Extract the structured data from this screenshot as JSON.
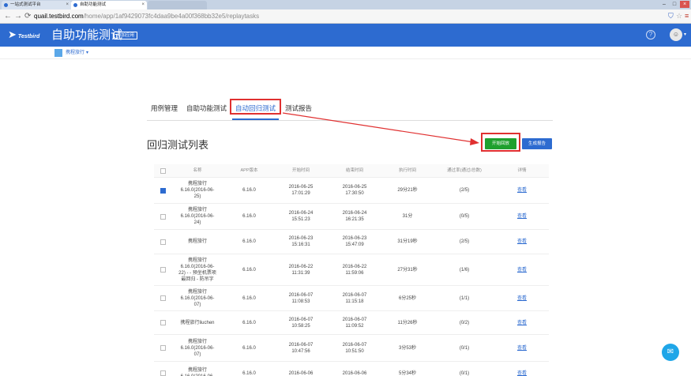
{
  "browser": {
    "tabs": [
      {
        "label": "一站式测试平台",
        "state": "inactive"
      },
      {
        "label": "自助功能测试",
        "state": "active"
      },
      {
        "label": "",
        "state": "faded"
      }
    ],
    "url_host": "quail.testbird.com",
    "url_path": "/home/app/1af9429073fc4daa9be4a00f368bb32e5/replaytasks",
    "back_icon": "arrow-left-icon",
    "forward_icon": "arrow-right-icon",
    "reload_icon": "reload-icon"
  },
  "header": {
    "logo_text": "Testbird",
    "title": "自助功能测试",
    "badge": "添加应用",
    "help_icon": "help-circle-icon",
    "avatar_icon": "user-avatar-icon"
  },
  "app_selector": {
    "name": "携程旅行",
    "caret": "▾"
  },
  "tabs": [
    {
      "label": "用例管理",
      "active": false
    },
    {
      "label": "自助功能测试",
      "active": false
    },
    {
      "label": "自动回归测试",
      "active": true
    },
    {
      "label": "测试报告",
      "active": false
    }
  ],
  "section": {
    "title": "回归测试列表",
    "start_button": "开始回放",
    "report_button": "生成报告"
  },
  "table": {
    "headers": [
      "",
      "名称",
      "APP版本",
      "开始时间",
      "结束时间",
      "执行时间",
      "通过率(通过/总数)",
      "详情"
    ],
    "rows": [
      {
        "name": [
          "携程旅行",
          "6.16.0(2016-06-",
          "25)"
        ],
        "version": "6.16.0",
        "start": [
          "2016-06-25",
          "17:01:29"
        ],
        "end": [
          "2016-06-25",
          "17:30:50"
        ],
        "duration": "29分21秒",
        "pass": "(2/5)",
        "detail": "查看",
        "checked": true
      },
      {
        "name": [
          "携程旅行",
          "6.16.0(2016-06-",
          "24)"
        ],
        "version": "6.16.0",
        "start": [
          "2016-06-24",
          "15:51:23"
        ],
        "end": [
          "2016-06-24",
          "16:21:35"
        ],
        "duration": "31分",
        "pass": "(0/5)",
        "detail": "查看",
        "checked": false
      },
      {
        "name": [
          "携程旅行"
        ],
        "version": "6.16.0",
        "start": [
          "2016-06-23",
          "15:16:31"
        ],
        "end": [
          "2016-06-23",
          "15:47:09"
        ],
        "duration": "31分19秒",
        "pass": "(2/5)",
        "detail": "查看",
        "checked": false
      },
      {
        "name": [
          "携程旅行",
          "6.16.0(2016-06-",
          "22) - - 预坐机票项",
          "最回归 - 防吊字"
        ],
        "version": "6.16.0",
        "start": [
          "2016-06-22",
          "11:31:39"
        ],
        "end": [
          "2016-06-22",
          "11:59:06"
        ],
        "duration": "27分31秒",
        "pass": "(1/6)",
        "detail": "查看",
        "checked": false
      },
      {
        "name": [
          "携程旅行",
          "6.16.0(2016-06-",
          "07)"
        ],
        "version": "6.16.0",
        "start": [
          "2016-06-07",
          "11:08:53"
        ],
        "end": [
          "2016-06-07",
          "11:15:18"
        ],
        "duration": "6分25秒",
        "pass": "(1/1)",
        "detail": "查看",
        "checked": false
      },
      {
        "name": [
          "携程旅行liuchen"
        ],
        "version": "6.16.0",
        "start": [
          "2016-06-07",
          "10:58:25"
        ],
        "end": [
          "2016-06-07",
          "11:09:52"
        ],
        "duration": "11分26秒",
        "pass": "(0/2)",
        "detail": "查看",
        "checked": false
      },
      {
        "name": [
          "携程旅行",
          "6.16.0(2016-06-",
          "07)"
        ],
        "version": "6.16.0",
        "start": [
          "2016-06-07",
          "10:47:56"
        ],
        "end": [
          "2016-06-07",
          "10:51:50"
        ],
        "duration": "3分53秒",
        "pass": "(0/1)",
        "detail": "查看",
        "checked": false
      },
      {
        "name": [
          "携程旅行",
          "6.16.0(2016-06-"
        ],
        "version": "6.16.0",
        "start": [
          "2016-06-06",
          ""
        ],
        "end": [
          "2016-06-06",
          ""
        ],
        "duration": "5分34秒",
        "pass": "(0/1)",
        "detail": "查看",
        "checked": false
      }
    ]
  },
  "chat_icon": "chat-bubble-icon",
  "colors": {
    "brand_blue": "#2d6bd0",
    "start_green": "#1fa02e",
    "annotation_red": "#e03030"
  }
}
